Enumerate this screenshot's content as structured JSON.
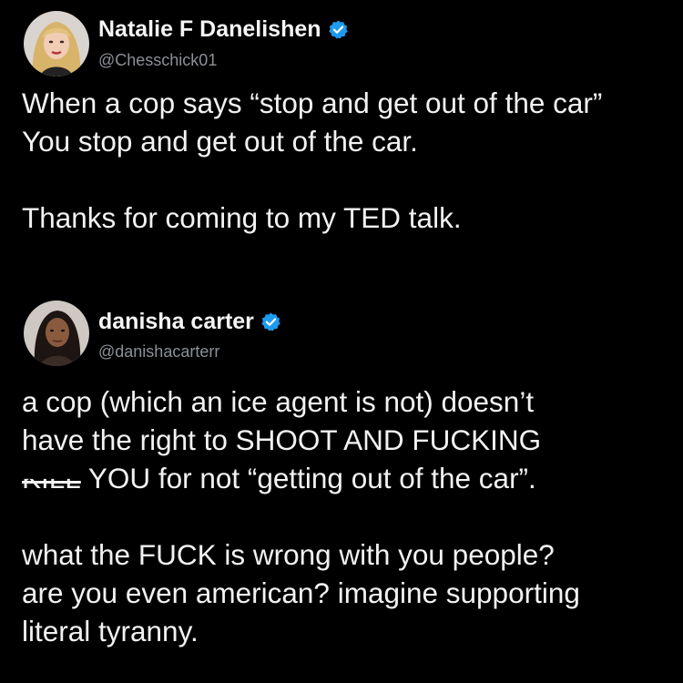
{
  "tweets": [
    {
      "display_name": "Natalie F Danelishen",
      "handle": "@Chesschick01",
      "verified": true,
      "avatar_icon": "avatar-blonde-woman",
      "lines": [
        "When a cop says “stop and get out of the car”",
        "You stop and get out of the car.",
        "Thanks for coming to my TED talk."
      ]
    },
    {
      "display_name": "danisha carter",
      "handle": "@danishacarterr",
      "verified": true,
      "avatar_icon": "avatar-dark-hair-woman",
      "lines": [
        "a cop (which an ice agent is not) doesn’t",
        "have the right to SHOOT AND FUCKING",
        "KILL",
        "YOU for not “getting out of the car”.",
        "what the FUCK is wrong with you people?",
        "are you even american? imagine supporting",
        "literal tyranny."
      ]
    }
  ],
  "colors": {
    "background": "#000000",
    "text": "#f2f2f2",
    "handle": "#8b9097",
    "verified_badge": "#1d9bf0"
  }
}
